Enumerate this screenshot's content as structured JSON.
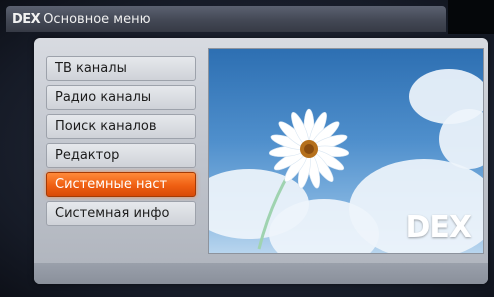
{
  "header": {
    "logo": "DEX",
    "title": "Основное меню"
  },
  "menu": {
    "items": [
      {
        "label": "ТВ каналы"
      },
      {
        "label": "Радио каналы"
      },
      {
        "label": "Поиск каналов"
      },
      {
        "label": "Редактор"
      },
      {
        "label": "Системные наст"
      },
      {
        "label": "Системная инфо"
      }
    ],
    "selected_index": 4
  },
  "picture": {
    "logo": "DEX"
  },
  "colors": {
    "selected": "#ef5f12",
    "panel": "#c2c6ce",
    "sky": "#4f8fcc"
  }
}
